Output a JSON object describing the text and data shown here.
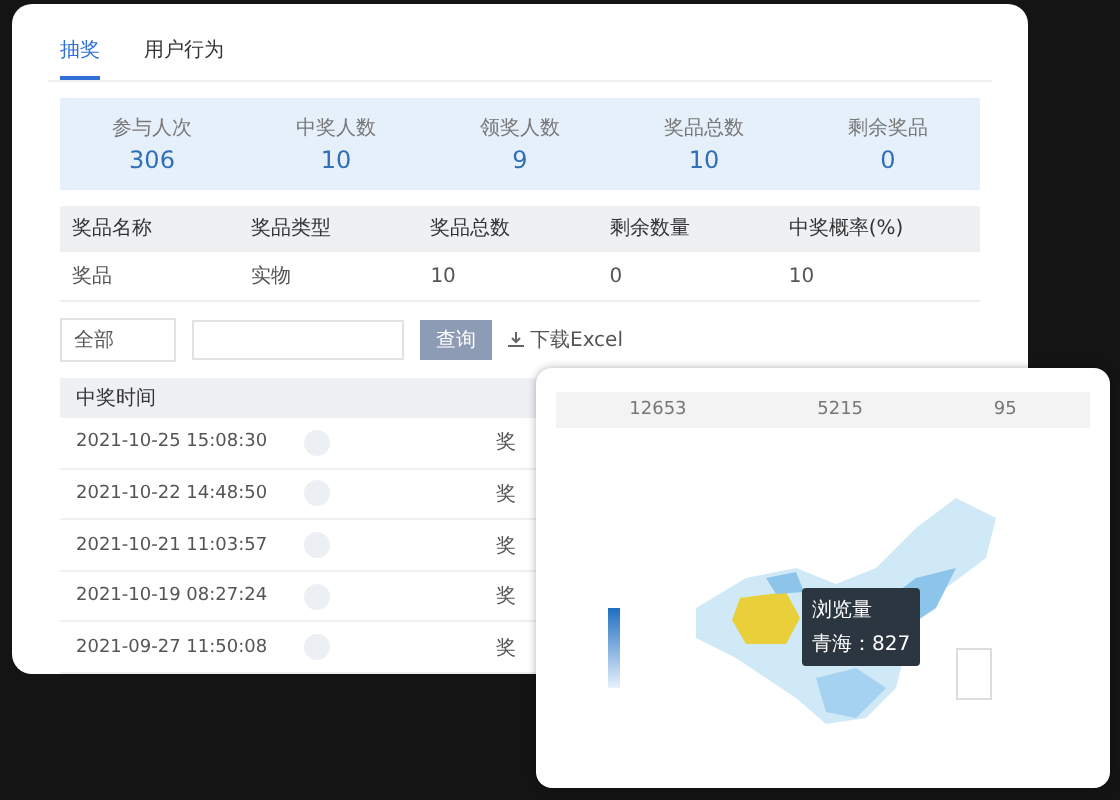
{
  "tabs": [
    {
      "label": "抽奖",
      "selected": true
    },
    {
      "label": "用户行为",
      "selected": false
    }
  ],
  "stats": [
    {
      "label": "参与人次",
      "value": "306"
    },
    {
      "label": "中奖人数",
      "value": "10"
    },
    {
      "label": "领奖人数",
      "value": "9"
    },
    {
      "label": "奖品总数",
      "value": "10"
    },
    {
      "label": "剩余奖品",
      "value": "0"
    }
  ],
  "prize_table": {
    "columns": [
      "奖品名称",
      "奖品类型",
      "奖品总数",
      "剩余数量",
      "中奖概率(%)"
    ],
    "rows": [
      [
        "奖品",
        "实物",
        "10",
        "0",
        "10"
      ]
    ]
  },
  "filter": {
    "select": "全部",
    "button": "查询",
    "link": "下载Excel"
  },
  "winners": {
    "columns": [
      "中奖时间"
    ],
    "rows": [
      {
        "time": "2021-10-25 15:08:30",
        "column_3": "奖"
      },
      {
        "time": "2021-10-22 14:48:50",
        "column_3": "奖"
      },
      {
        "time": "2021-10-21 11:03:57",
        "column_3": "奖"
      },
      {
        "time": "2021-10-19 08:27:24",
        "column_3": "奖"
      },
      {
        "time": "2021-09-27 11:50:08",
        "column_3": "奖"
      }
    ]
  },
  "map_panel": {
    "stats": [
      "12653",
      "5215",
      "95"
    ],
    "tooltip": {
      "title": "浏览量",
      "value": "青海：827"
    }
  }
}
